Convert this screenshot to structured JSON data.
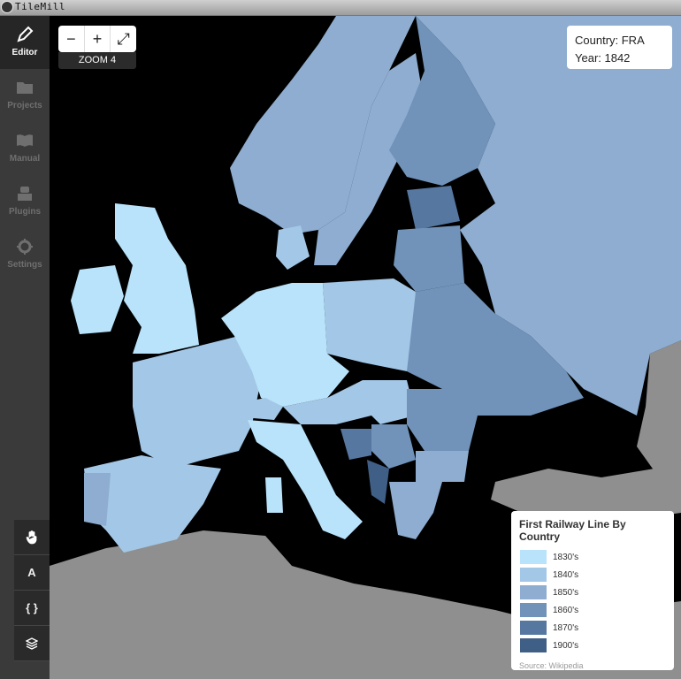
{
  "window": {
    "title": "TileMill"
  },
  "sidebar": {
    "items": [
      {
        "label": "Editor",
        "icon": "pencil-icon",
        "active": true
      },
      {
        "label": "Projects",
        "icon": "folder-icon",
        "active": false
      },
      {
        "label": "Manual",
        "icon": "book-icon",
        "active": false
      },
      {
        "label": "Plugins",
        "icon": "plugin-icon",
        "active": false
      },
      {
        "label": "Settings",
        "icon": "gear-icon",
        "active": false
      }
    ]
  },
  "tools": {
    "pan_icon": "hand-icon",
    "text_label": "A",
    "code_label": "{ }",
    "layers_icon": "layers-icon"
  },
  "zoom": {
    "minus": "−",
    "plus": "+",
    "fullscreen": "⤢",
    "label": "ZOOM 4"
  },
  "tooltip": {
    "country": "Country: FRA",
    "year": "Year: 1842"
  },
  "legend": {
    "title": "First Railway Line By Country",
    "items": [
      {
        "label": "1830's",
        "color": "#b9e3fa"
      },
      {
        "label": "1840's",
        "color": "#a3c7e6"
      },
      {
        "label": "1850's",
        "color": "#8eadd0"
      },
      {
        "label": "1860's",
        "color": "#7193b9"
      },
      {
        "label": "1870's",
        "color": "#5677a0"
      },
      {
        "label": "1900's",
        "color": "#3f5f86"
      }
    ],
    "source": "Source: Wikipedia"
  },
  "colors": {
    "land_other": "#8f8f8f",
    "sea": "#000000",
    "sidebar": "#3a3a3a"
  }
}
